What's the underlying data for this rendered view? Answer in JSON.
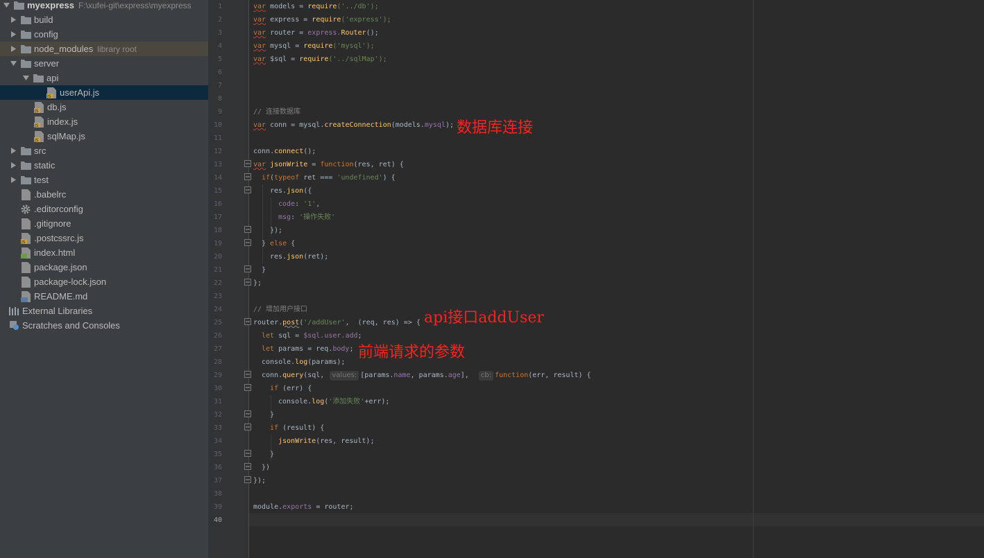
{
  "project": {
    "root_name": "myexpress",
    "root_path": "F:\\xufei-git\\express\\myexpress"
  },
  "tree": {
    "build": "build",
    "config": "config",
    "node_modules": "node_modules",
    "node_modules_hint": "library root",
    "server": "server",
    "api": "api",
    "userApi": "userApi.js",
    "db": "db.js",
    "index_js": "index.js",
    "sqlMap": "sqlMap.js",
    "src": "src",
    "static": "static",
    "test": "test",
    "babelrc": ".babelrc",
    "editorconfig": ".editorconfig",
    "gitignore": ".gitignore",
    "postcssrc": ".postcssrc.js",
    "index_html": "index.html",
    "package_json": "package.json",
    "package_lock": "package-lock.json",
    "readme": "README.md",
    "external_libraries": "External Libraries",
    "scratches": "Scratches and Consoles"
  },
  "icon_names": {
    "folder": "folder-icon",
    "js_file": "js-file-icon",
    "gear": "gear-icon",
    "html_file": "html-file-icon",
    "markdown_file": "markdown-file-icon",
    "libraries": "libraries-icon",
    "scratches": "scratches-icon"
  },
  "colors": {
    "sidebar_bg": "#3c3f41",
    "editor_bg": "#2b2b2b",
    "selected_row": "#0d293e",
    "keyword": "#cc7832",
    "string": "#6a8759",
    "function": "#ffc66d",
    "property": "#9876aa",
    "comment": "#808080",
    "annotation": "#ff2020"
  },
  "editor": {
    "line_numbers": [
      "1",
      "2",
      "3",
      "4",
      "5",
      "6",
      "7",
      "8",
      "9",
      "10",
      "11",
      "12",
      "13",
      "14",
      "15",
      "16",
      "17",
      "18",
      "19",
      "20",
      "21",
      "22",
      "23",
      "24",
      "25",
      "26",
      "27",
      "28",
      "29",
      "30",
      "31",
      "32",
      "33",
      "34",
      "35",
      "36",
      "37",
      "38",
      "39",
      "40"
    ],
    "current_line": 40,
    "code": {
      "t_var": "var",
      "t_let": "let",
      "t_if": "if",
      "t_typeof": "typeof",
      "t_else": "else",
      "t_function": "function",
      "t_require": "require",
      "t_models": " models = ",
      "t_express": " express = ",
      "t_router": " router = ",
      "t_mysql": " mysql = ",
      "t_sql": " $sql = ",
      "s_db": "('../db');",
      "s_express": "('express');",
      "s_mysql": "('mysql');",
      "s_sqlmap": "('../sqlMap');",
      "p_express_obj": "express.",
      "f_router": "Router",
      "p_call_end": "();",
      "c_conn_db": "// 连接数据库",
      "l10_a": " conn = mysql.",
      "f_createConnection": "createConnection",
      "l10_b": "(models.",
      "l10_mysql": "mysql",
      "l10_c": ");",
      "l12_a": "conn.",
      "f_connect": "connect",
      "l12_b": "();",
      "l13_name": " jsonWrite",
      "l13_eq": " = ",
      "l13_params": "(res, ret) {",
      "l14_a": "(",
      "l14_b": " ret === ",
      "s_undefined": "'undefined'",
      "l14_c": ") {",
      "l15_a": "res.",
      "f_json": "json",
      "l15_b": "({",
      "p_code": "code",
      "l16_b": ": ",
      "s_one": "'1'",
      "l16_c": ",",
      "p_msg": "msg",
      "s_fail": "'操作失败'",
      "l18": "});",
      "l19_a": "} ",
      "l19_b": " {",
      "l20_a": "res.",
      "l20_b": "(ret);",
      "l21": "}",
      "l22": "};",
      "c_add_user": "// 增加用户接口",
      "l25_a": "router.",
      "f_post": "post",
      "l25_b": "(",
      "s_adduser": "'/addUser'",
      "l25_c": ",  (req, res) => {",
      "l26_a": " sql = ",
      "l26_b": "$sql.",
      "p_user": "user",
      "l26_dot": ".",
      "p_add": "add",
      "l26_c": ";",
      "l27_a": " params = req.",
      "p_body": "body",
      "l27_b": ";",
      "l28_a": "console.",
      "f_log": "log",
      "l28_b": "(params);",
      "l29_a": "conn.",
      "f_query": "query",
      "l29_b": "(sql, ",
      "hint_values": "values:",
      "l29_c": "[params.",
      "p_name": "name",
      "l29_d": ", params.",
      "p_age": "age",
      "l29_e": "],  ",
      "hint_cb": "cb:",
      "l29_f": "(err, result) {",
      "l30_b": " (err) {",
      "l31_a": "console.",
      "l31_b": "(",
      "s_add_fail": "'添加失败'",
      "l31_c": "+err);",
      "l32": "}",
      "l33_b": " (result) {",
      "f_jsonWrite": "jsonWrite",
      "l34_b": "(res, result);",
      "l35": "}",
      "l36": "})",
      "l37": "});",
      "l39_a": "module.",
      "p_exports": "exports",
      "l39_b": " = router;"
    }
  },
  "annotations": {
    "db_connection": "数据库连接",
    "api_adduser": "api接口addUser",
    "frontend_params": "前端请求的参数"
  }
}
